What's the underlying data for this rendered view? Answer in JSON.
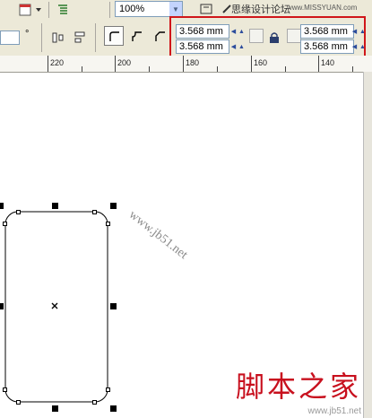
{
  "toolbar": {
    "zoom_value": "100%",
    "partial_text": "思缘设计论坛",
    "partial_url": "www.MISSYUAN.com"
  },
  "property_bar": {
    "outline_field_value": "",
    "degree_symbol": "°",
    "corner_top_left": "3.568 mm",
    "corner_bottom_left": "3.568 mm",
    "corner_top_right": "3.568 mm",
    "corner_bottom_right": "3.568 mm"
  },
  "ruler": {
    "ticks": [
      "220",
      "200",
      "180",
      "160",
      "140"
    ]
  },
  "watermark": "www.jb51.net",
  "footer": {
    "logo_text": "脚本之家",
    "url_text": "www.jb51.net"
  },
  "colors": {
    "toolbar_bg": "#ece9d8",
    "highlight_border": "#d0161a",
    "logo_red": "#c8101e"
  },
  "icons": [
    "page-icon",
    "dropdown-arrow-icon",
    "align-icon",
    "distribute-icon",
    "wrap-icon",
    "round-corner-icon",
    "scallop-corner-icon",
    "chamfer-corner-icon",
    "lock-icon"
  ]
}
